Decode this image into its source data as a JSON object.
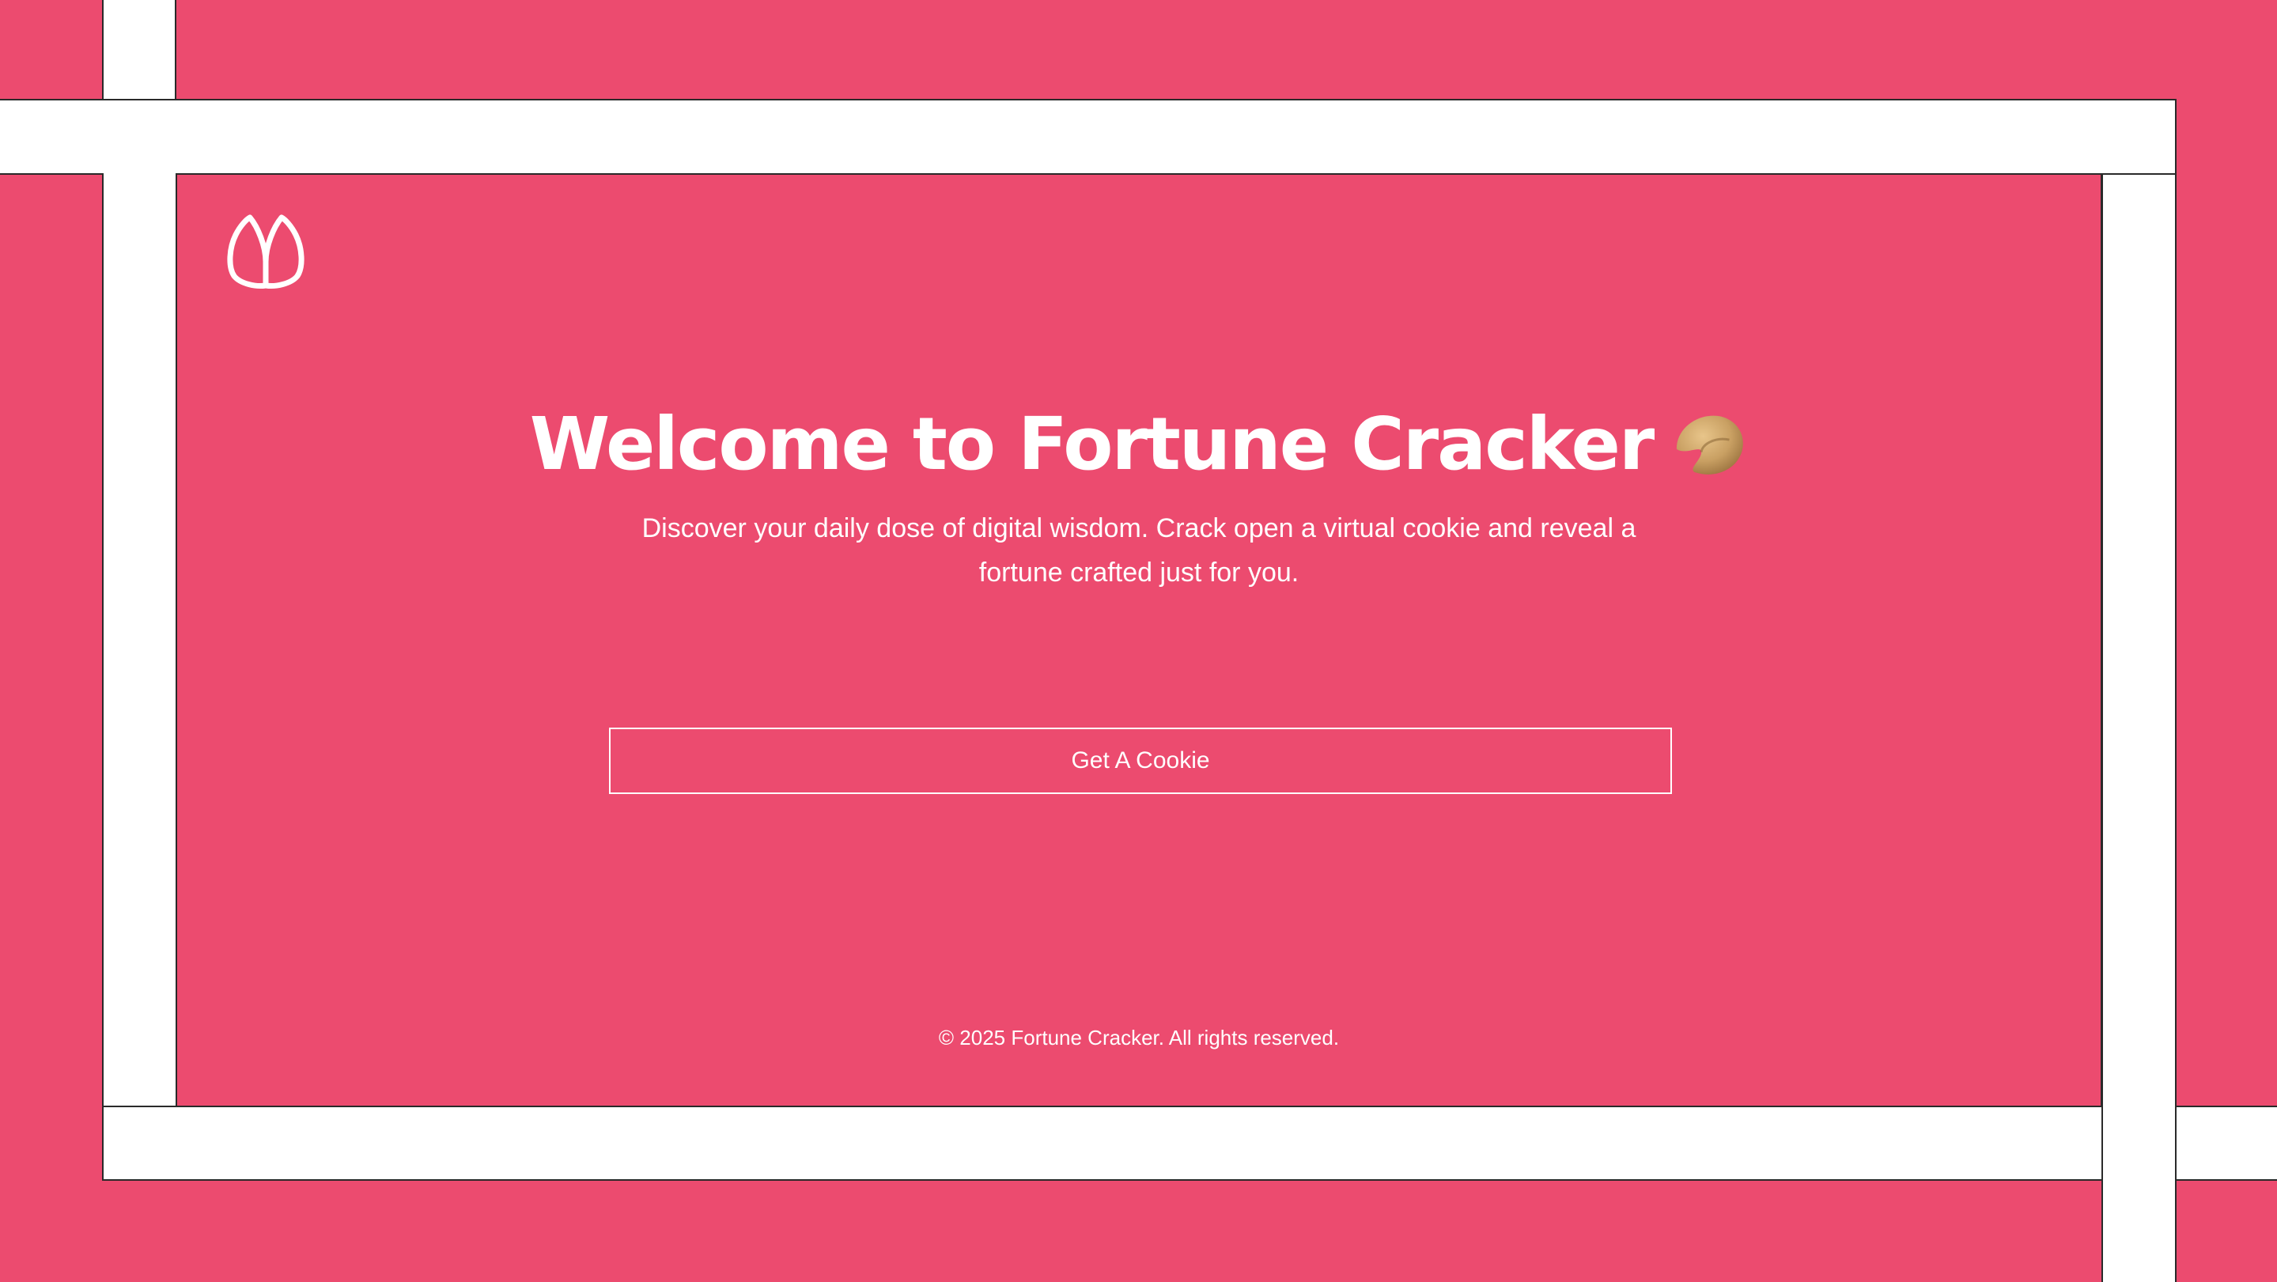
{
  "app": {
    "name": "Fortune Cracker"
  },
  "hero": {
    "title": "Welcome to Fortune Cracker",
    "subtitle": "Discover your daily dose of digital wisdom. Crack open a virtual cookie and reveal a fortune crafted just for you.",
    "title_icon": "fortune-cookie-icon"
  },
  "cta": {
    "label": "Get A Cookie"
  },
  "footer": {
    "copyright": "© 2025 Fortune Cracker. All rights reserved."
  },
  "logo": {
    "icon": "bunny-ears-logo-icon"
  },
  "colors": {
    "background": "#ec4b6f",
    "frame": "#ffffff",
    "frame_border": "#2a2a2a",
    "text": "#ffffff",
    "cookie": "#c9a063"
  }
}
